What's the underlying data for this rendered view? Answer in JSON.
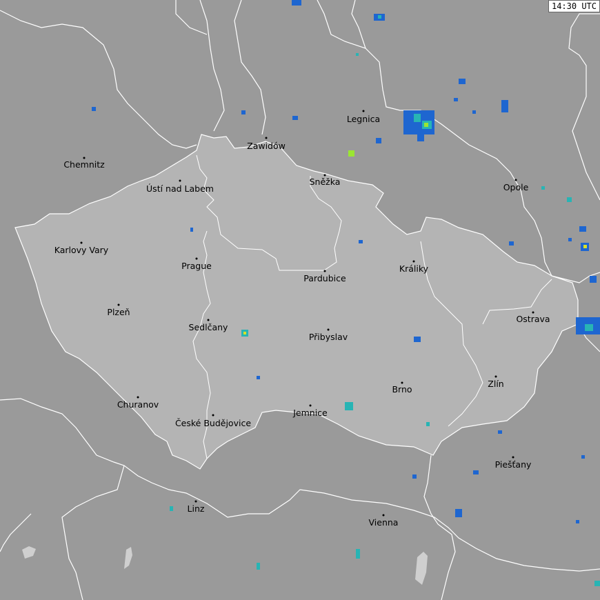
{
  "timestamp": "14:30 UTC",
  "map": {
    "colors": {
      "background": "#9a9a9a",
      "country_fill": "#b4b4b4",
      "border": "#ffffff",
      "water": "#cfcfcf"
    },
    "cities": [
      {
        "name": "Legnica"
      },
      {
        "name": "Zawidów"
      },
      {
        "name": "Chemnitz"
      },
      {
        "name": "Ústí nad Labem"
      },
      {
        "name": "Sněžka"
      },
      {
        "name": "Opole"
      },
      {
        "name": "Karlovy Vary"
      },
      {
        "name": "Prague"
      },
      {
        "name": "Pardubice"
      },
      {
        "name": "Králiky"
      },
      {
        "name": "Plzeň"
      },
      {
        "name": "Sedlčany"
      },
      {
        "name": "Přibyslav"
      },
      {
        "name": "Ostrava"
      },
      {
        "name": "Zlín"
      },
      {
        "name": "Brno"
      },
      {
        "name": "Churanov"
      },
      {
        "name": "České Budějovice"
      },
      {
        "name": "Jemnice"
      },
      {
        "name": "Piešťany"
      },
      {
        "name": "Linz"
      },
      {
        "name": "Vienna"
      }
    ]
  }
}
